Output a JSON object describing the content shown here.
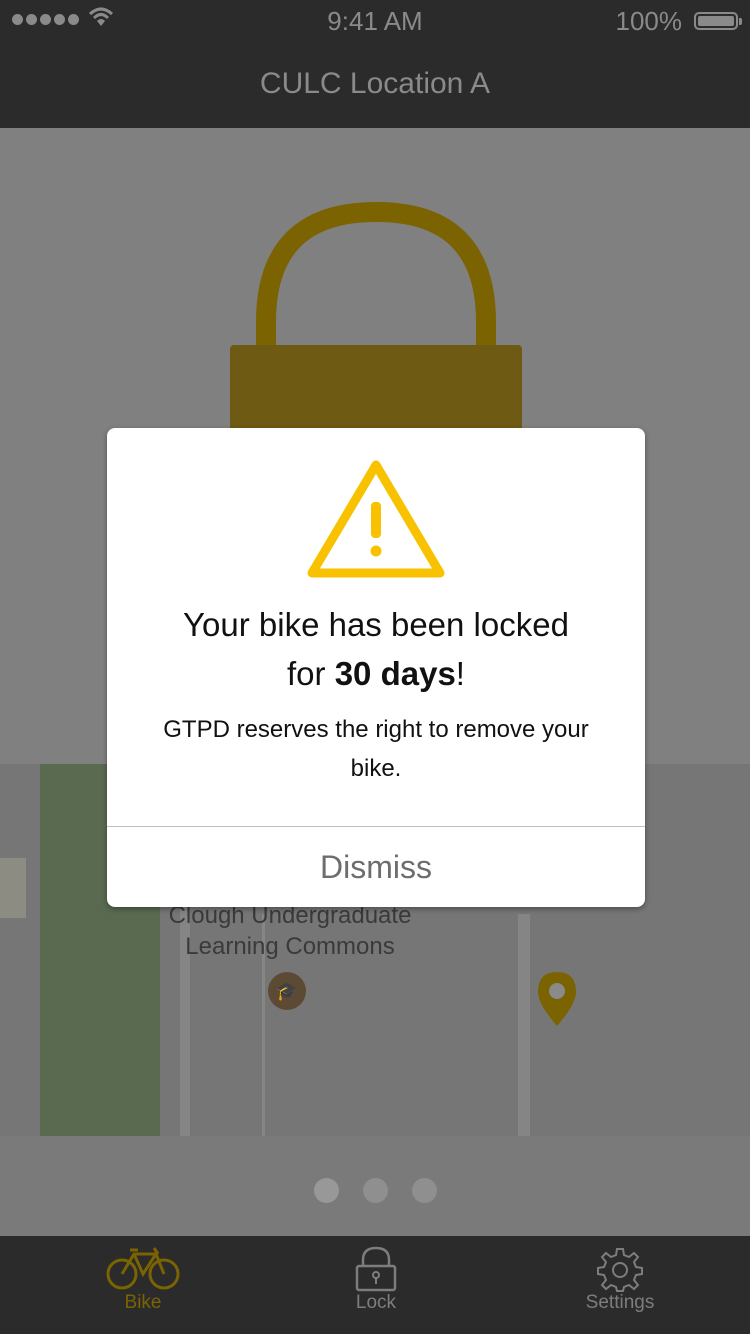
{
  "status_bar": {
    "time": "9:41 AM",
    "battery": "100%",
    "signal_icon": "signal-dots-icon",
    "wifi_icon": "wifi-icon",
    "battery_icon": "battery-icon"
  },
  "nav": {
    "title": "CULC Location A"
  },
  "map": {
    "label_line1": "Clough Undergraduate",
    "label_line2": "Learning Commons",
    "poi_icon": "graduation-cap-icon",
    "pin_icon": "map-pin-icon"
  },
  "pager": {
    "count": 3,
    "active_index": 0
  },
  "dialog": {
    "icon": "warning-icon",
    "title_prefix": "Your bike has been locked",
    "title_for": "for ",
    "title_bold": "30 days",
    "title_suffix": "!",
    "message": "GTPD reserves the right to remove your bike.",
    "dismiss_label": "Dismiss"
  },
  "tabs": [
    {
      "label": "Bike",
      "icon": "bike-icon",
      "active": true
    },
    {
      "label": "Lock",
      "icon": "lock-icon",
      "active": false
    },
    {
      "label": "Settings",
      "icon": "gear-icon",
      "active": false
    }
  ],
  "colors": {
    "accent": "#F9C200",
    "accent_dimmed": "#7A6300",
    "bar_background": "#2B2B2B",
    "overlay_gray": "#808080"
  }
}
